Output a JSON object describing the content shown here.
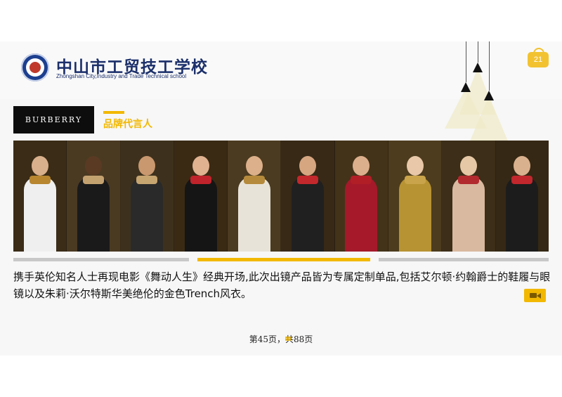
{
  "header": {
    "school_name_cn": "中山市工贸技工学校",
    "school_name_en": "Zhongshan City,Industry and Trade Technical school",
    "page_badge": "21"
  },
  "brand": {
    "logo_text": "BURBERRY",
    "section_title": "品牌代言人"
  },
  "body_text": "携手英伦知名人士再现电影《舞动人生》经典开场,此次出镜产品皆为专属定制单品,包括艾尔顿·约翰爵士的鞋履与眼镜以及朱莉·沃尔特斯华美绝伦的金色Trench风衣。",
  "pagination": "第45页，共88页",
  "colors": {
    "accent": "#f2b800",
    "navy": "#1b2f6a",
    "divider_gray": "#c8c8c8"
  },
  "icons": [
    "school-logo-icon",
    "shopping-bag-icon",
    "pendant-lamp-icon",
    "video-camera-icon"
  ]
}
